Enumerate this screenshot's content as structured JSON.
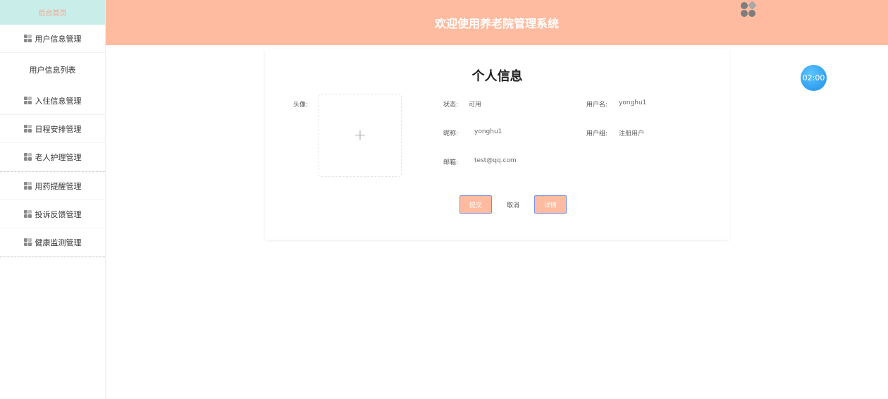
{
  "header": {
    "title": "欢迎使用养老院管理系统",
    "icon": "grid-cluster-icon"
  },
  "sidebar": {
    "home": "后台首页",
    "items": [
      {
        "label": "用户信息管理"
      },
      {
        "label": "入住信息管理"
      },
      {
        "label": "日程安排管理"
      },
      {
        "label": "老人护理管理"
      },
      {
        "label": "用药提醒管理"
      },
      {
        "label": "投诉反馈管理"
      },
      {
        "label": "健康监测管理"
      }
    ],
    "sub": "用户信息列表"
  },
  "timer": "02:00",
  "profile": {
    "title": "个人信息",
    "avatar_label": "头像:",
    "avatar_plus": "+",
    "status_label": "状态:",
    "status_value": "可用",
    "username_label": "用户名:",
    "username_value": "yonghu1",
    "nickname_label": "昵称:",
    "nickname_value": "yonghu1",
    "group_label": "用户组:",
    "group_value": "注册用户",
    "email_label": "邮箱:",
    "email_value": "test@qq.com"
  },
  "buttons": {
    "submit": "提交",
    "cancel": "取消",
    "detail": "详情"
  },
  "colors": {
    "header": "#ffbba0",
    "sidebar_home": "#c9eeea",
    "timer": "#2a9af0"
  }
}
